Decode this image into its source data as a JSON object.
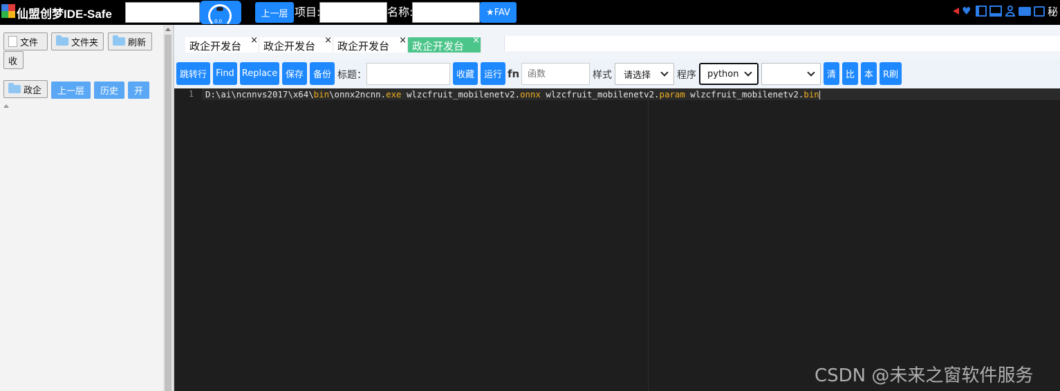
{
  "app": {
    "title": "仙盟创梦IDE-Safe"
  },
  "topbar": {
    "search_value": "",
    "round_button_text": "0.0",
    "up_button": "上一层",
    "project_label": "项目:",
    "project_value": "",
    "name_label": "名称:",
    "name_value": "",
    "fav_button": "★FAV",
    "tail_glyph": "秘"
  },
  "left": {
    "file_button": "文件",
    "folder_button": "文件夹",
    "refresh_button": "刷新",
    "collapse_button": "收",
    "node_label": "政企",
    "up_button": "上一层",
    "history_button": "历史",
    "open_button": "开"
  },
  "tabs": [
    {
      "label": "政企开发台",
      "close": "×",
      "active": false
    },
    {
      "label": "政企开发台",
      "close": "×",
      "active": false
    },
    {
      "label": "政企开发台",
      "close": "×",
      "active": false
    },
    {
      "label": "政企开发台",
      "close": "×",
      "active": true
    }
  ],
  "toolbar": {
    "goto_line": "跳转行",
    "find": "Find",
    "replace": "Replace",
    "save": "保存",
    "backup": "备份",
    "title_label": "标题：",
    "title_value": "",
    "collect": "收藏",
    "run": "运行",
    "fn_label": "fn",
    "fn_placeholder": "函数",
    "style_label": "样式",
    "style_selected": "请选择",
    "program_label": "程序",
    "program_selected": "python",
    "second_selected": "",
    "clear": "清",
    "compare": "比",
    "local": "本",
    "rflush": "R刷"
  },
  "editor": {
    "line_number": "1",
    "code": {
      "p1": "D:\\ai\\ncnnvs2017\\x64\\",
      "k1": "bin",
      "p2": "\\onnx2ncnn.",
      "k2": "exe",
      "p3": " wlzcfruit_mobilenetv2.",
      "k3": "onnx",
      "p4": " wlzcfruit_mobilenetv2.",
      "k4": "param",
      "p5": " wlzcfruit_mobilenetv2.",
      "k5": "bin"
    }
  },
  "watermark": "CSDN @未来之窗软件服务",
  "colors": {
    "accent_blue": "#1e88ff",
    "active_tab": "#4cc58a",
    "editor_bg": "#1e1e1e",
    "keyword": "#f0b020"
  }
}
